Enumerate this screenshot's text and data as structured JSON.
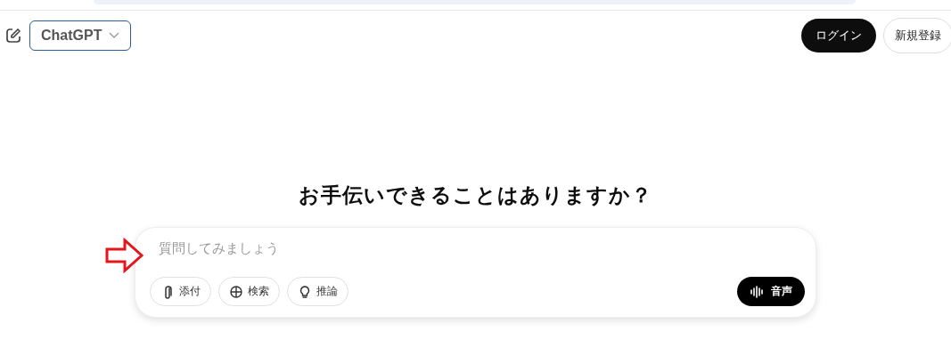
{
  "header": {
    "model_selector": "ChatGPT",
    "login": "ログイン",
    "signup": "新規登録"
  },
  "heading": "お手伝いできることはありますか？",
  "composer": {
    "placeholder": "質問してみましょう",
    "tools": [
      {
        "kind": "attach",
        "label": "添付"
      },
      {
        "kind": "search",
        "label": "検索"
      },
      {
        "kind": "reason",
        "label": "推論"
      }
    ],
    "voice": "音声"
  }
}
